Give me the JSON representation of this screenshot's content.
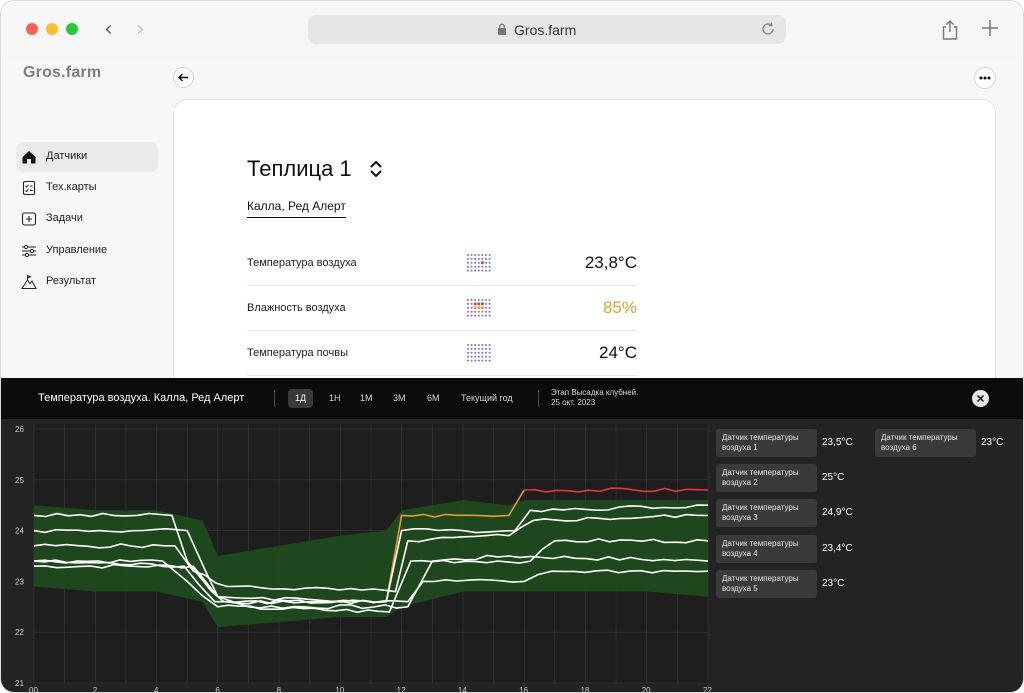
{
  "browser": {
    "url": "Gros.farm"
  },
  "sidebar": {
    "logo": "Gros.farm",
    "items": [
      {
        "label": "Датчики",
        "icon": "home-icon",
        "active": true
      },
      {
        "label": "Тех.карты",
        "icon": "checklist-icon",
        "active": false
      },
      {
        "label": "Задачи",
        "icon": "task-plus-icon",
        "active": false
      },
      {
        "label": "Управление",
        "icon": "sliders-icon",
        "active": false
      },
      {
        "label": "Результат",
        "icon": "mountain-flag-icon",
        "active": false
      }
    ]
  },
  "main": {
    "title": "Теплица 1",
    "crop_tab": "Калла, Ред Алерт",
    "sensors": [
      {
        "name": "Температура воздуха",
        "value": "23,8°C",
        "status": "normal"
      },
      {
        "name": "Влажность воздуха",
        "value": "85%",
        "status": "warning"
      },
      {
        "name": "Температура почвы",
        "value": "24°C",
        "status": "normal"
      }
    ]
  },
  "panel": {
    "title": "Температура воздуха. Калла, Ред Алерт",
    "ranges": [
      "1Д",
      "1Н",
      "1М",
      "3М",
      "6М",
      "Текущий год"
    ],
    "active_range": "1Д",
    "stage_line1": "Этап Высадка клубней.",
    "stage_line2": "25 окт. 2023",
    "legend": [
      {
        "name": "Датчик температуры воздуха 1",
        "value": "23,5°C"
      },
      {
        "name": "Датчик температуры воздуха 2",
        "value": "25°C"
      },
      {
        "name": "Датчик температуры воздуха 3",
        "value": "24,9°C"
      },
      {
        "name": "Датчик температуры воздуха 4",
        "value": "23,4°C"
      },
      {
        "name": "Датчик температуры воздуха 5",
        "value": "23°C"
      },
      {
        "name": "Датчик температуры воздуха 6",
        "value": "23°C"
      }
    ]
  },
  "colors": {
    "accent_warning": "#e2a036",
    "band": "#1f4a1f",
    "alert_line": "#e03a3a",
    "warn_line": "#e89b2e"
  },
  "chart_data": {
    "type": "line",
    "x_ticks": [
      "00",
      "2",
      "4",
      "6",
      "8",
      "10",
      "12",
      "14",
      "16",
      "18",
      "20",
      "22"
    ],
    "y_ticks": [
      "21",
      "22",
      "23",
      "24",
      "25",
      "26"
    ],
    "ylim": [
      21,
      26
    ],
    "xlim": [
      0,
      22
    ],
    "grid": true,
    "band": {
      "x": [
        0,
        2,
        4,
        5.5,
        6,
        8,
        10,
        11.5,
        12,
        14,
        15.5,
        16,
        18,
        20,
        22
      ],
      "upper": [
        24.5,
        24.4,
        24.4,
        24.2,
        23.5,
        23.7,
        23.9,
        24.0,
        24.4,
        24.6,
        24.5,
        24.6,
        24.6,
        24.6,
        24.6
      ],
      "lower": [
        22.9,
        22.8,
        22.8,
        22.6,
        22.1,
        22.2,
        22.3,
        22.3,
        22.5,
        22.8,
        22.8,
        22.8,
        22.8,
        22.8,
        22.7
      ]
    },
    "series": [
      {
        "values_x": [
          0,
          4.5,
          5,
          5.8,
          6.2,
          11.5,
          12,
          14.5,
          15.5,
          16,
          22
        ],
        "values_y": [
          24.3,
          24.3,
          23.4,
          22.8,
          22.6,
          22.6,
          24.3,
          24.3,
          24.3,
          24.8,
          24.8
        ],
        "color_by_range": true
      },
      {
        "values_x": [
          0,
          5,
          5.6,
          6,
          11.5,
          12,
          14,
          15.7,
          16.2,
          22
        ],
        "values_y": [
          24.0,
          24.0,
          23.2,
          22.7,
          22.6,
          24.0,
          24.0,
          24.0,
          24.4,
          24.5
        ]
      },
      {
        "values_x": [
          0,
          4.6,
          5.2,
          6.3,
          11.8,
          12.2,
          15.5,
          16.3,
          22
        ],
        "values_y": [
          23.7,
          23.7,
          23.2,
          22.9,
          22.8,
          23.8,
          23.9,
          24.2,
          24.3
        ]
      },
      {
        "values_x": [
          0,
          4.2,
          5,
          6,
          11.6,
          12.3,
          16.2,
          17,
          22
        ],
        "values_y": [
          23.4,
          23.4,
          23.0,
          22.5,
          22.4,
          23.4,
          23.4,
          23.8,
          23.8
        ]
      },
      {
        "values_x": [
          0,
          5.2,
          6,
          7,
          12.2,
          13,
          15.5,
          22
        ],
        "values_y": [
          23.3,
          23.3,
          22.7,
          22.5,
          22.5,
          23.4,
          23.5,
          23.4
        ]
      },
      {
        "values_x": [
          0,
          4.9,
          5.9,
          12.2,
          12.7,
          16,
          16.9,
          22
        ],
        "values_y": [
          23.4,
          23.3,
          22.6,
          22.6,
          23.0,
          23.0,
          23.2,
          23.2
        ]
      }
    ]
  }
}
